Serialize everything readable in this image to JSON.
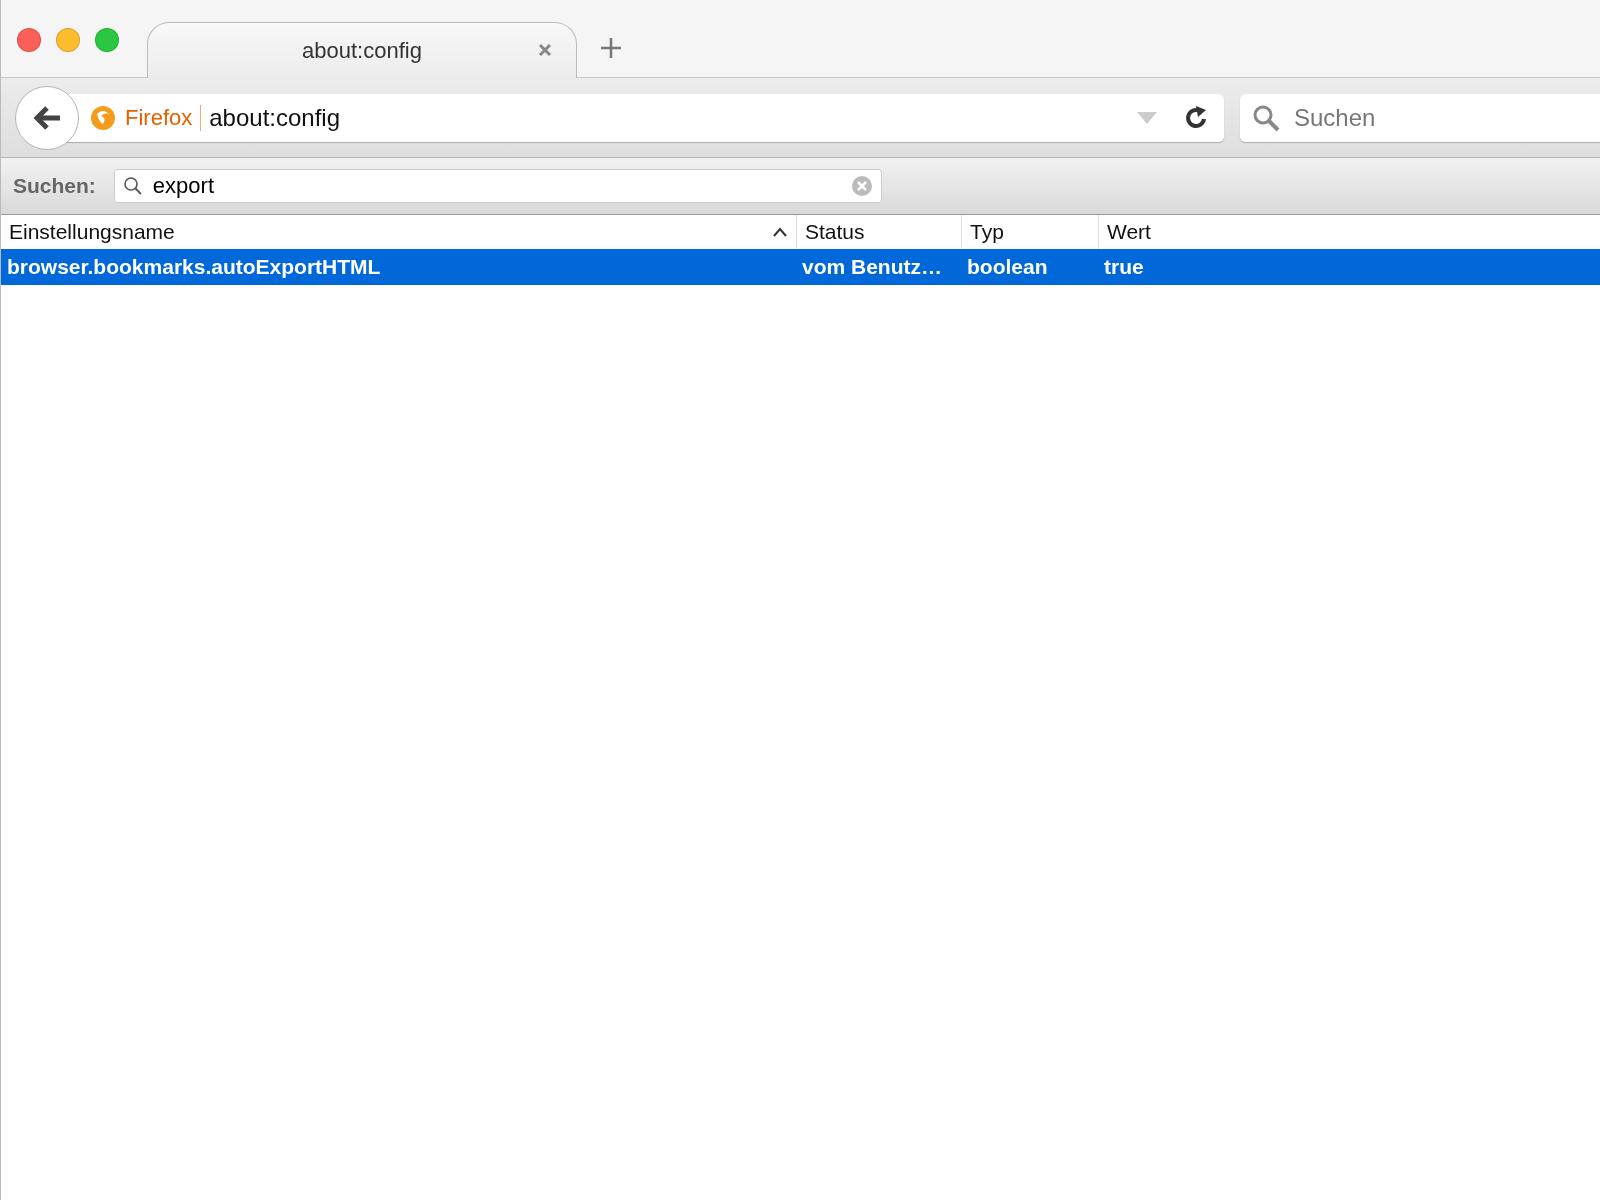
{
  "tabs": [
    {
      "label": "about:config",
      "selected": true
    }
  ],
  "url_bar": {
    "identity": "Firefox",
    "value": "about:config"
  },
  "search_bar": {
    "placeholder": "Suchen"
  },
  "filter": {
    "label": "Suchen:",
    "value": "export"
  },
  "table": {
    "columns": [
      {
        "label": "Einstellungsname",
        "sorted": true
      },
      {
        "label": "Status",
        "sorted": false
      },
      {
        "label": "Typ",
        "sorted": false
      },
      {
        "label": "Wert",
        "sorted": false
      }
    ],
    "rows": [
      {
        "selected": true,
        "cells": [
          "browser.bookmarks.autoExportHTML",
          "vom Benutz…",
          "boolean",
          "true"
        ]
      }
    ]
  }
}
